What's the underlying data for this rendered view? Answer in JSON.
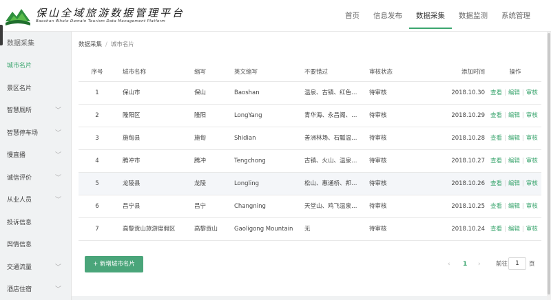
{
  "brand": {
    "title": "保山全域旅游数据管理平台",
    "subtitle": "Baoshan Whole Domain Tourism Data Management Platform"
  },
  "nav": {
    "items": [
      "首页",
      "信息发布",
      "数据采集",
      "数据监测",
      "系统管理"
    ],
    "active_index": 2
  },
  "sidebar": {
    "header": "数据采集",
    "items": [
      {
        "label": "城市名片",
        "has_children": false
      },
      {
        "label": "景区名片",
        "has_children": false
      },
      {
        "label": "智慧厕所",
        "has_children": true
      },
      {
        "label": "智慧停车场",
        "has_children": true
      },
      {
        "label": "慢直播",
        "has_children": true
      },
      {
        "label": "诚信评价",
        "has_children": true
      },
      {
        "label": "从业人员",
        "has_children": true
      },
      {
        "label": "投诉信息",
        "has_children": false
      },
      {
        "label": "舆情信息",
        "has_children": false
      },
      {
        "label": "交通流量",
        "has_children": true
      },
      {
        "label": "酒店住宿",
        "has_children": true
      }
    ],
    "active_index": 0
  },
  "breadcrumb": {
    "root": "数据采集",
    "separator": "/",
    "current": "城市名片"
  },
  "table": {
    "headers": {
      "idx": "序号",
      "name": "城市名称",
      "abbr": "缩写",
      "en": "英文缩写",
      "spots": "不要错过",
      "status": "审核状态",
      "date": "添加时间",
      "ops": "操作"
    },
    "actions": [
      "查看",
      "编辑",
      "审核"
    ],
    "rows": [
      {
        "idx": "1",
        "name": "保山市",
        "abbr": "保山",
        "en": "Baoshan",
        "spots": "温泉、古镇、红色旅游",
        "status": "待审核",
        "date": "2018.10.30"
      },
      {
        "idx": "2",
        "name": "隆阳区",
        "abbr": "隆阳",
        "en": "LongYang",
        "spots": "青华海、永昌阁、太保山",
        "status": "待审核",
        "date": "2018.10.29"
      },
      {
        "idx": "3",
        "name": "施甸县",
        "abbr": "施甸",
        "en": "Shidian",
        "spots": "善洲林场、石瓢温泉、姚关",
        "status": "待审核",
        "date": "2018.10.28"
      },
      {
        "idx": "4",
        "name": "腾冲市",
        "abbr": "腾冲",
        "en": "Tengchong",
        "spots": "古镇、火山、温泉、热海",
        "status": "待审核",
        "date": "2018.10.27"
      },
      {
        "idx": "5",
        "name": "龙陵县",
        "abbr": "龙陵",
        "en": "Longling",
        "spots": "松山、惠通桥、邦腊掌",
        "status": "待审核",
        "date": "2018.10.26"
      },
      {
        "idx": "6",
        "name": "昌宁县",
        "abbr": "昌宁",
        "en": "Changning",
        "spots": "天堂山、鸡飞温泉、茶山",
        "status": "待审核",
        "date": "2018.10.25"
      },
      {
        "idx": "7",
        "name": "高黎贡山旅游度假区",
        "abbr": "高黎贡山",
        "en": "Gaoligong Mountain",
        "spots": "无",
        "status": "待审核",
        "date": "2018.10.24"
      }
    ],
    "highlight_row": 4
  },
  "add_button": {
    "label": "+ 新增城市名片"
  },
  "pagination": {
    "prev": "‹",
    "page": "1",
    "next": "›",
    "goto_label": "前往",
    "goto_value": "1",
    "unit": "页"
  },
  "colors": {
    "accent": "#3aa56e",
    "button": "#4aa57a"
  }
}
